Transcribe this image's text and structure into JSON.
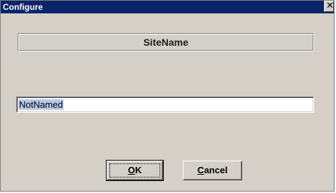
{
  "window": {
    "title": "Configure",
    "close_glyph": "✕",
    "close_icon": "close-icon"
  },
  "header": {
    "label": "SiteName"
  },
  "name_field": {
    "value": "NotNamed"
  },
  "buttons": {
    "ok_mnemonic": "O",
    "ok_rest": "K",
    "cancel_mnemonic": "C",
    "cancel_rest": "ancel"
  },
  "colors": {
    "titlebar": "#0a246a",
    "dialog_bg": "#d4d0c8",
    "selection": "#b8c8e8"
  }
}
